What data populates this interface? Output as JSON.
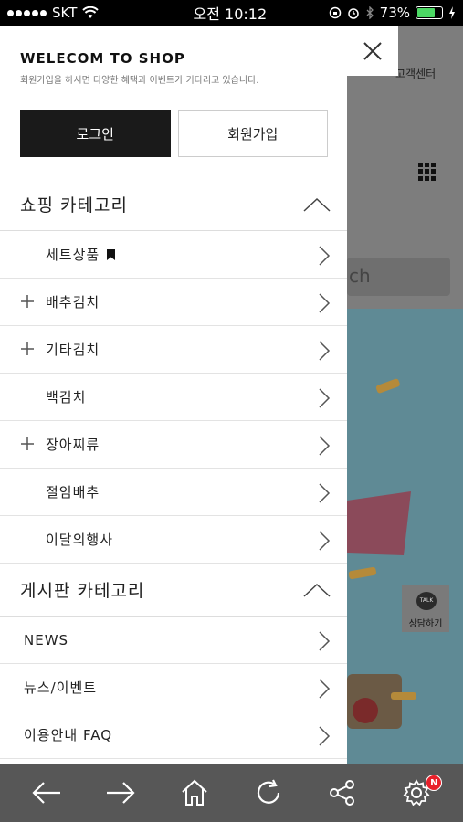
{
  "status": {
    "carrier": "SKT",
    "time": "오전 10:12",
    "battery": "73%",
    "battery_level": 0.73
  },
  "background": {
    "customer_center": "고객센터",
    "search_hint": "ch",
    "talk_button_label": "상담하기",
    "talk_icon_text": "TALK"
  },
  "drawer": {
    "welcome_title": "WELECOM TO SHOP",
    "welcome_subtitle": "회원가입을 하시면 다양한 혜택과 이벤트가 기다리고 있습니다.",
    "login_label": "로그인",
    "join_label": "회원가입",
    "shopping_category": {
      "title": "쇼핑 카테고리",
      "items": [
        {
          "label": "세트상품",
          "expandable": false,
          "bookmark": true
        },
        {
          "label": "배추김치",
          "expandable": true
        },
        {
          "label": "기타김치",
          "expandable": true
        },
        {
          "label": "백김치",
          "expandable": false
        },
        {
          "label": "장아찌류",
          "expandable": true
        },
        {
          "label": "절임배추",
          "expandable": false
        },
        {
          "label": "이달의행사",
          "expandable": false
        }
      ]
    },
    "board_category": {
      "title": "게시판 카테고리",
      "items": [
        {
          "label": "NEWS"
        },
        {
          "label": "뉴스/이벤트"
        },
        {
          "label": "이용안내 FAQ"
        }
      ]
    }
  },
  "toolbar": {
    "buttons": [
      "back-arrow-icon",
      "forward-arrow-icon",
      "home-icon",
      "refresh-icon",
      "share-icon",
      "settings-icon"
    ],
    "settings_badge": "N",
    "badge_color": "#e8202a"
  }
}
